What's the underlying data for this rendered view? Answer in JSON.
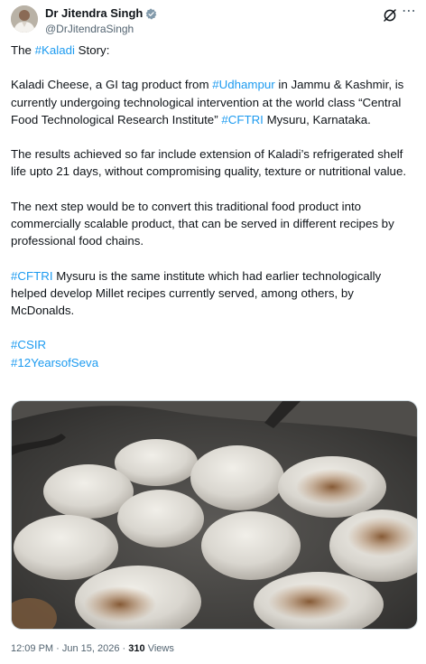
{
  "author": {
    "name": "Dr Jitendra Singh",
    "handle": "@DrJitendraSingh"
  },
  "icons": {
    "verified": "verified-badge-icon",
    "grok": "grok-icon",
    "more": "more-options-icon"
  },
  "tweet": {
    "p1": {
      "pre": "The ",
      "tag": "#Kaladi",
      "post": " Story:"
    },
    "p2": {
      "a": "Kaladi Cheese, a GI tag product from ",
      "tag1": "#Udhampur",
      "b": " in Jammu & Kashmir, is currently undergoing technological intervention at the world class “Central Food Technological Research Institute” ",
      "tag2": "#CFTRI",
      "c": " Mysuru, Karnataka."
    },
    "p3": "The results achieved so far include extension of Kaladi’s refrigerated shelf life upto 21 days, without compromising quality, texture or nutritional value.",
    "p4": "The next step would be to convert this traditional food product into commercially scalable product, that can be served in different recipes by professional food chains.",
    "p5": {
      "tag": "#CFTRI",
      "text": " Mysuru is the same institute which had earlier technologically helped develop Millet recipes currently served, among others, by McDonalds."
    },
    "hashtags": [
      "#CSIR",
      "#12YearsofSeva"
    ]
  },
  "meta": {
    "time": "12:09 PM",
    "sep1": " · ",
    "date": "Jun 15, 2026",
    "sep2": " · ",
    "views_count": "310",
    "views_label": " Views"
  },
  "colors": {
    "link": "#1d9bf0",
    "secondary_text": "#536471",
    "verified": "#829aab"
  }
}
